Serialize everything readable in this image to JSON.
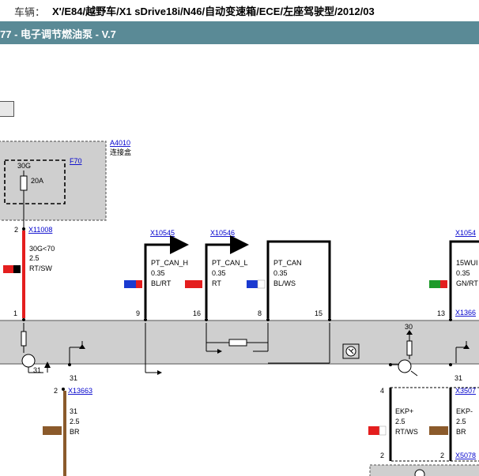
{
  "header": {
    "vehicle_label": "车辆：",
    "vehicle_value": "X'/E84/越野车/X1 sDrive18i/N46/自动变速箱/ECE/左座驾驶型/2012/03",
    "title": "77 - 电子调节燃油泵 - V.7"
  },
  "diagram": {
    "junction_box": {
      "id": "A4010",
      "name": "连接盒"
    },
    "fuse": {
      "id": "F70",
      "supply": "30G",
      "rating": "20A"
    },
    "connectors": {
      "left_top": "X11008",
      "can_h": "X10545",
      "can_l": "X10546",
      "right_top": "X1054",
      "right_mid": "X1366",
      "bottom_left": "X13663",
      "bottom_right": "X3507",
      "bottom_far": "X5078"
    },
    "wires": {
      "supply": {
        "signal": "30G<70",
        "size": "2.5",
        "color": "RT/SW"
      },
      "can_h": {
        "signal": "PT_CAN_H",
        "size": "0.35",
        "color": "BL/RT"
      },
      "can_l": {
        "signal": "PT_CAN_L",
        "size": "0.35",
        "color": "RT"
      },
      "can": {
        "signal": "PT_CAN",
        "size": "0.35",
        "color": "BL/WS"
      },
      "right": {
        "signal": "15WUI",
        "size": "0.35",
        "color": "GN/RT"
      },
      "ground": {
        "signal": "31",
        "size": "2.5",
        "color": "BR"
      },
      "ekp_plus": {
        "signal": "EKP+",
        "size": "2.5",
        "color": "RT/WS"
      },
      "ekp_minus": {
        "signal": "EKP-",
        "size": "2.5",
        "color": "BR"
      }
    },
    "pins": {
      "p1": "1",
      "p2_top": "2",
      "p9": "9",
      "p16": "16",
      "p8": "8",
      "p15": "15",
      "p13": "13",
      "p30": "30",
      "p31_a": "31",
      "p31_b": "31",
      "p31_c": "31",
      "p2_bottom_left": "2",
      "p4": "4",
      "p2_bottom_mid": "2",
      "p2_bottom_right": "2"
    },
    "colors": {
      "red": "#e41e1e",
      "blue": "#1a3ad0",
      "green": "#1e9a2a",
      "brown": "#8b5a2b",
      "module_gray": "#cfcfcf"
    }
  }
}
